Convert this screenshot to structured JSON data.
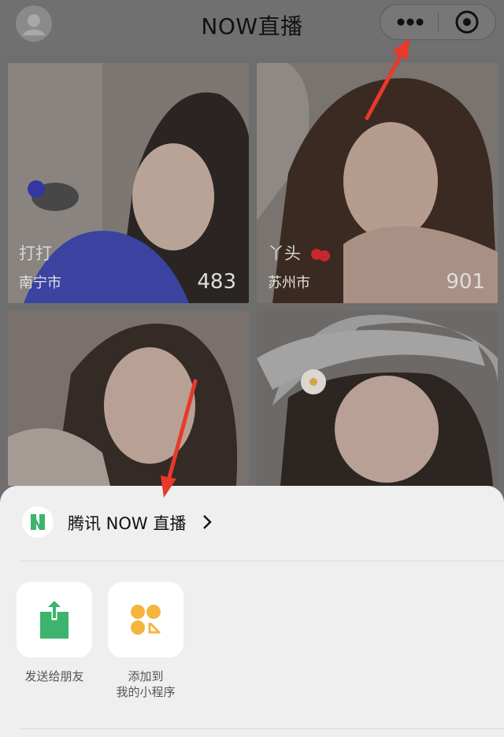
{
  "header": {
    "title": "NOW直播"
  },
  "feed": [
    {
      "nickname": "打打",
      "city": "南宁市",
      "count": "483"
    },
    {
      "nickname": "丫头",
      "city": "苏州市",
      "count": "901"
    },
    {
      "nickname": "",
      "city": "",
      "count": ""
    },
    {
      "nickname": "",
      "city": "",
      "count": ""
    }
  ],
  "sheet": {
    "app_name": "腾讯 NOW 直播",
    "actions": [
      {
        "label": "发送给朋友",
        "icon": "share-icon"
      },
      {
        "label": "添加到\n我的小程序",
        "icon": "add-mini-program-icon"
      }
    ]
  },
  "colors": {
    "accent_green": "#3cb46e",
    "accent_yellow": "#f5b53d",
    "arrow_red": "#e8392b"
  }
}
